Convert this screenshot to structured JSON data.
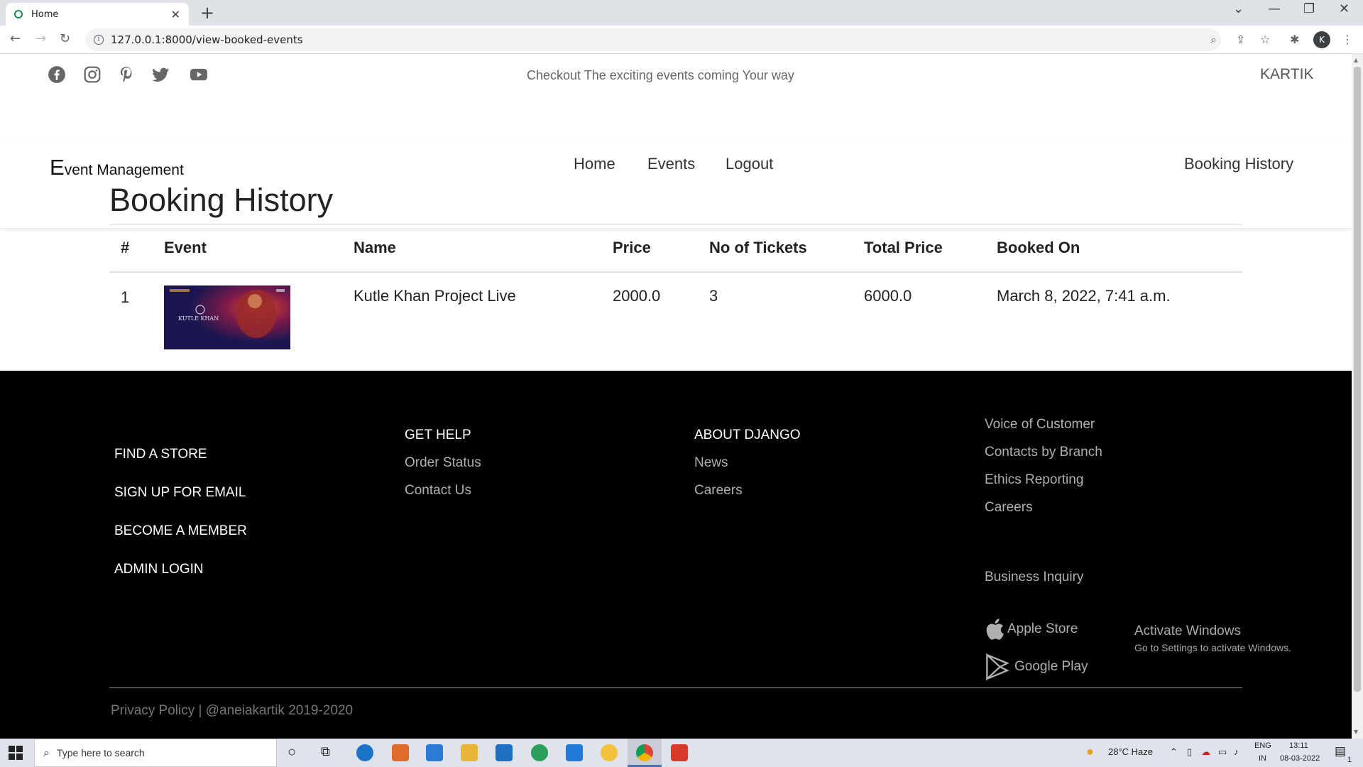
{
  "browser": {
    "tab_title": "Home",
    "url": "127.0.0.1:8000/view-booked-events",
    "profile_initial": "K"
  },
  "site": {
    "tagline": "Checkout The exciting events coming Your way",
    "username": "KARTIK",
    "brand_first": "E",
    "brand_rest": "vent Management",
    "nav": [
      "Home",
      "Events",
      "Logout"
    ],
    "nav_right": "Booking History",
    "social_icons": [
      "facebook-icon",
      "instagram-icon",
      "pinterest-icon",
      "twitter-icon",
      "youtube-icon"
    ]
  },
  "history": {
    "title": "Booking History",
    "columns": [
      "#",
      "Event",
      "Name",
      "Price",
      "No of Tickets",
      "Total Price",
      "Booked On"
    ],
    "rows": [
      {
        "index": "1",
        "thumb_text": "KUTLE KHAN",
        "name": "Kutle Khan Project Live",
        "price": "2000.0",
        "tickets": "3",
        "total": "6000.0",
        "booked_on": "March 8, 2022, 7:41 a.m."
      }
    ]
  },
  "footer": {
    "main_links": [
      "FIND A STORE",
      "SIGN UP FOR EMAIL",
      "BECOME A MEMBER",
      "ADMIN LOGIN"
    ],
    "help": {
      "heading": "GET HELP",
      "links": [
        "Order Status",
        "Contact Us"
      ]
    },
    "about": {
      "heading": "ABOUT DJANGO",
      "links": [
        "News",
        "Careers"
      ]
    },
    "right_links": [
      "Voice of Customer",
      "Contacts by Branch",
      "Ethics Reporting",
      "Careers"
    ],
    "business": "Business Inquiry",
    "apple": "Apple Store",
    "google": "Google Play",
    "copyright": "Privacy Policy | @aneiakartik 2019-2020"
  },
  "watermark": {
    "title": "Activate Windows",
    "subtitle": "Go to Settings to activate Windows."
  },
  "taskbar": {
    "search_placeholder": "Type here to search",
    "weather": "28°C  Haze",
    "lang_top": "ENG",
    "lang_bottom": "IN",
    "time": "13:11",
    "date": "08-03-2022",
    "notification_count": "1"
  }
}
